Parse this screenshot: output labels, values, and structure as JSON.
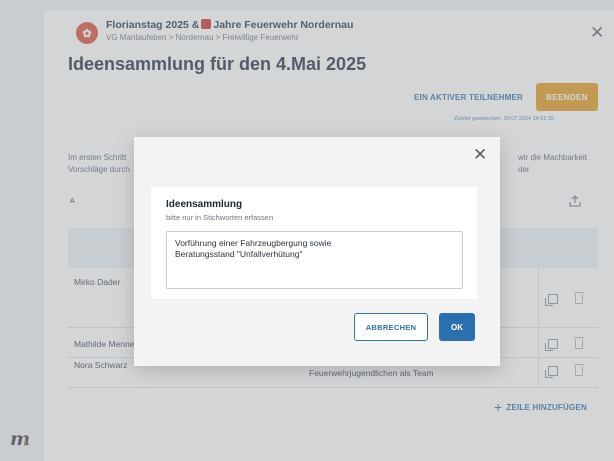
{
  "header": {
    "title_part1": "Florianstag 2025 &",
    "title_part2": "Jahre Feuerwehr Nordernau",
    "breadcrumb": "VG Mantaufeben > Nordernau > Freiwillige Feuerwehr",
    "close_icon": "close-icon"
  },
  "page": {
    "title": "Ideensammlung für den 4.Mai 2025",
    "participants_label": "EIN AKTIVER TEILNEHMER",
    "end_button": "BEENDEN",
    "saved_info": "Zuletzt gespeichert: 30.07.2024 14:51:15",
    "intro_line1": "Im ersten Schritt",
    "intro_line2": "wir die Machbarkeit der",
    "intro_line3": "Vorschläge durch",
    "column_a": "A"
  },
  "table": {
    "rows": [
      {
        "name": "Mirko Dader"
      },
      {
        "name": "Mathilde Menne"
      },
      {
        "name": "Nora Schwarz",
        "text": "Feuerwehrjugendlichen als Team"
      }
    ],
    "add_row_label": "ZEILE HINZUFÜGEN"
  },
  "modal": {
    "field_label": "Ideensammlung",
    "field_hint": "bitte nur in Stichworten erfassen",
    "field_value": "Vorführung einer Fahrzeugbergung sowie\nBeratungsstand \"Unfallverhütung\"",
    "cancel_label": "ABBRECHEN",
    "ok_label": "OK"
  },
  "branding": {
    "logo_text": "m",
    "logo_mark": "!"
  },
  "colors": {
    "accent_blue": "#2c6fae",
    "end_button_orange": "#e39a1d",
    "header_icon_red": "#d8503a"
  }
}
